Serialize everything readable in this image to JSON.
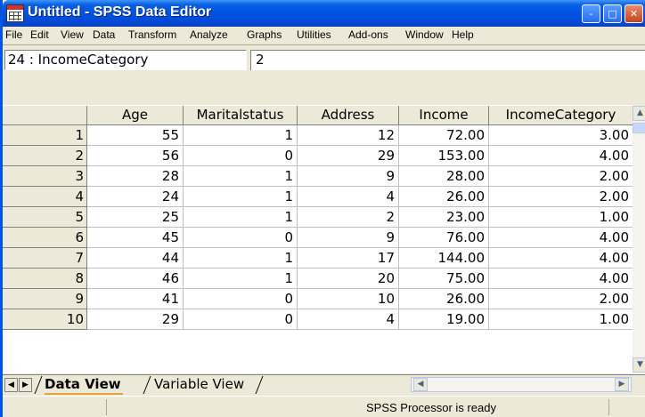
{
  "window": {
    "title": "Untitled - SPSS Data Editor",
    "controls": {
      "minimize": "-",
      "maximize": "□",
      "close": "✕"
    }
  },
  "menu": [
    {
      "label": "File"
    },
    {
      "label": "Edit"
    },
    {
      "label": "View"
    },
    {
      "label": "Data"
    },
    {
      "label": "Transform"
    },
    {
      "label": "Analyze"
    },
    {
      "label": "Graphs"
    },
    {
      "label": "Utilities"
    },
    {
      "label": "Add-ons"
    },
    {
      "label": "Window"
    },
    {
      "label": "Help"
    }
  ],
  "cell_editor": {
    "reference": "24 : IncomeCategory",
    "value": "2"
  },
  "grid": {
    "columns": [
      "Age",
      "Maritalstatus",
      "Address",
      "Income",
      "IncomeCategory"
    ],
    "rows": [
      {
        "n": "1",
        "cells": [
          "55",
          "1",
          "12",
          "72.00",
          "3.00"
        ]
      },
      {
        "n": "2",
        "cells": [
          "56",
          "0",
          "29",
          "153.00",
          "4.00"
        ]
      },
      {
        "n": "3",
        "cells": [
          "28",
          "1",
          "9",
          "28.00",
          "2.00"
        ]
      },
      {
        "n": "4",
        "cells": [
          "24",
          "1",
          "4",
          "26.00",
          "2.00"
        ]
      },
      {
        "n": "5",
        "cells": [
          "25",
          "1",
          "2",
          "23.00",
          "1.00"
        ]
      },
      {
        "n": "6",
        "cells": [
          "45",
          "0",
          "9",
          "76.00",
          "4.00"
        ]
      },
      {
        "n": "7",
        "cells": [
          "44",
          "1",
          "17",
          "144.00",
          "4.00"
        ]
      },
      {
        "n": "8",
        "cells": [
          "46",
          "1",
          "20",
          "75.00",
          "4.00"
        ]
      },
      {
        "n": "9",
        "cells": [
          "41",
          "0",
          "10",
          "26.00",
          "2.00"
        ]
      },
      {
        "n": "10",
        "cells": [
          "29",
          "0",
          "4",
          "19.00",
          "1.00"
        ]
      }
    ]
  },
  "tabs": {
    "data_view": "Data View",
    "variable_view": "Variable View"
  },
  "status": {
    "text": "SPSS Processor  is ready"
  },
  "colors": {
    "title_bar": "#0053e1",
    "chrome": "#ece9d8",
    "active_tab_underline": "#e8a23a"
  }
}
